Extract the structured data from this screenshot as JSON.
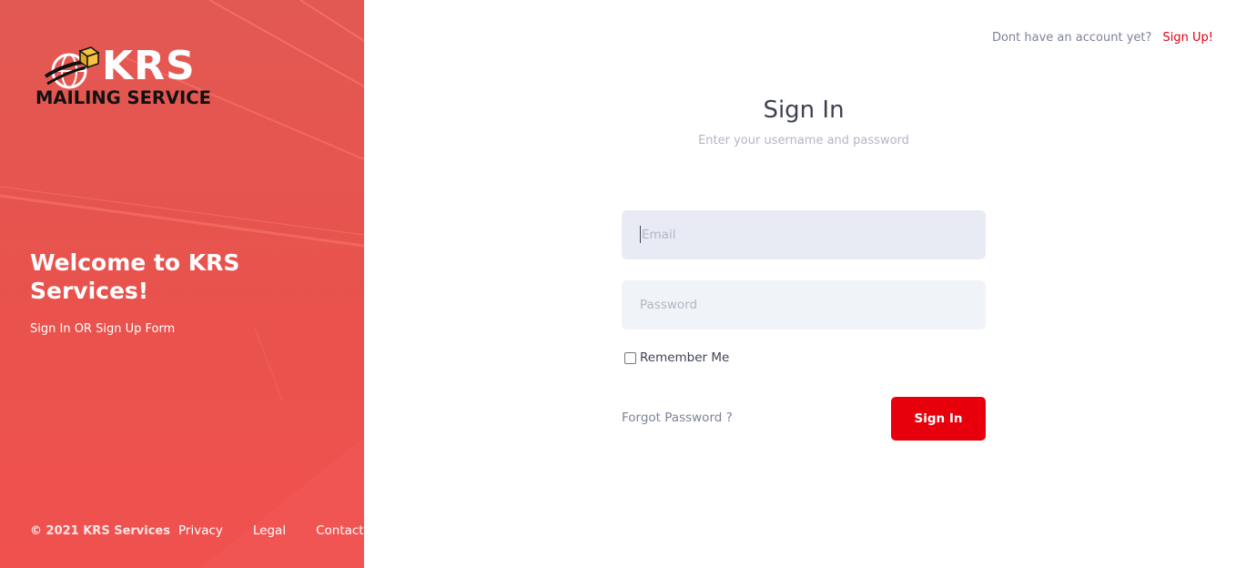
{
  "aside": {
    "logo": {
      "brand": "KRS",
      "tagline": "MAILING SERVICE"
    },
    "welcome_title": "Welcome to KRS Services!",
    "welcome_subtitle": "Sign In OR Sign Up Form",
    "footer": {
      "copyright": "© 2021 KRS Services",
      "links": [
        "Privacy",
        "Legal",
        "Contact"
      ]
    }
  },
  "topbar": {
    "question": "Dont have an account yet?",
    "signup_link": "Sign Up!"
  },
  "form": {
    "title": "Sign In",
    "subtitle": "Enter your username and password",
    "email_placeholder": "Email",
    "email_value": "",
    "password_placeholder": "Password",
    "password_value": "",
    "remember_label": "Remember Me",
    "remember_checked": false,
    "forgot_link": "Forgot Password ?",
    "submit_label": "Sign In"
  },
  "colors": {
    "accent": "#e7000b",
    "aside_bg": "#e9524d",
    "heading": "#3f4254",
    "muted": "#b5b5c3"
  }
}
